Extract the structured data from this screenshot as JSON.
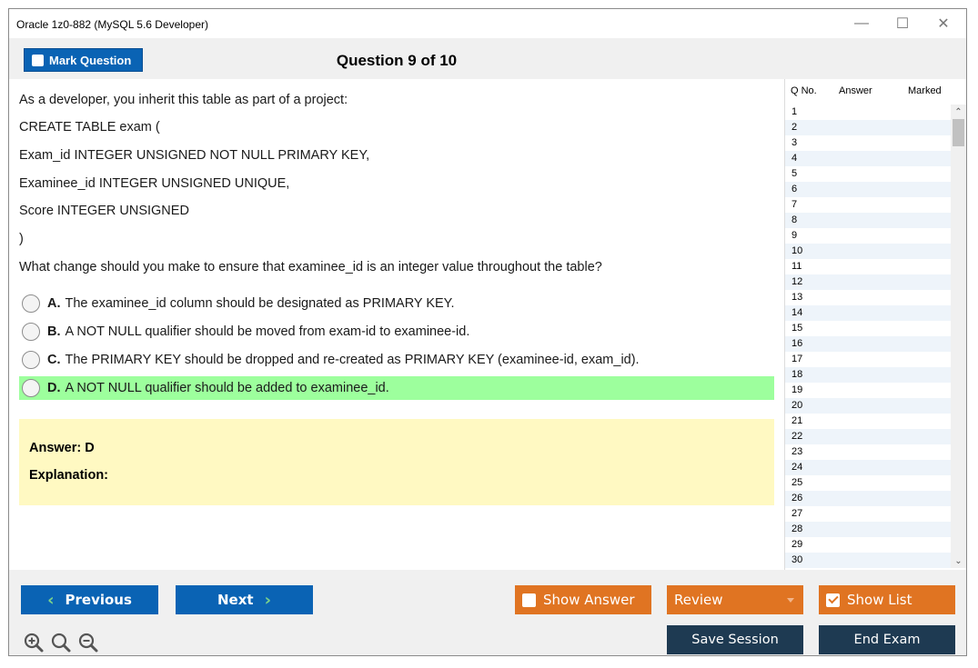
{
  "window": {
    "title": "Oracle 1z0-882 (MySQL 5.6 Developer)",
    "controls": [
      "minimize-icon",
      "maximize-icon",
      "close-icon"
    ]
  },
  "header": {
    "mark_label": "Mark Question",
    "question_title": "Question 9 of 10"
  },
  "question": {
    "lines": [
      "As a developer, you inherit this table as part of a project:",
      "CREATE TABLE exam (",
      "Exam_id INTEGER UNSIGNED NOT NULL PRIMARY KEY,",
      "Examinee_id INTEGER UNSIGNED UNIQUE,",
      "Score INTEGER UNSIGNED",
      ")",
      "What change should you make to ensure that examinee_id is an integer value throughout the table?"
    ],
    "options": [
      {
        "letter": "A.",
        "text": "The examinee_id column should be designated as PRIMARY KEY.",
        "correct": false
      },
      {
        "letter": "B.",
        "text": "A NOT NULL qualifier should be moved from exam-id to examinee-id.",
        "correct": false
      },
      {
        "letter": "C.",
        "text": "The PRIMARY KEY should be dropped and re-created as PRIMARY KEY (examinee-id, exam_id).",
        "correct": false
      },
      {
        "letter": "D.",
        "text": "A NOT NULL qualifier should be added to examinee_id.",
        "correct": true
      }
    ],
    "answer_label": "Answer: D",
    "explanation_label": "Explanation:",
    "correct_color": "#9dff9d",
    "answer_box_color": "#fff9c2"
  },
  "sidepanel": {
    "headers": [
      "Q No.",
      "Answer",
      "Marked"
    ],
    "rows": [
      "1",
      "2",
      "3",
      "4",
      "5",
      "6",
      "7",
      "8",
      "9",
      "10",
      "11",
      "12",
      "13",
      "14",
      "15",
      "16",
      "17",
      "18",
      "19",
      "20",
      "21",
      "22",
      "23",
      "24",
      "25",
      "26",
      "27",
      "28",
      "29",
      "30"
    ]
  },
  "footer": {
    "previous_label": "Previous",
    "next_label": "Next",
    "show_answer_label": "Show Answer",
    "review_label": "Review",
    "show_list_label": "Show List",
    "save_session_label": "Save Session",
    "end_exam_label": "End Exam",
    "zoom_icons": [
      "zoom-in-icon",
      "zoom-reset-icon",
      "zoom-out-icon"
    ],
    "blue": "#0a63b4",
    "orange": "#e07422",
    "dark": "#1e3a52"
  }
}
